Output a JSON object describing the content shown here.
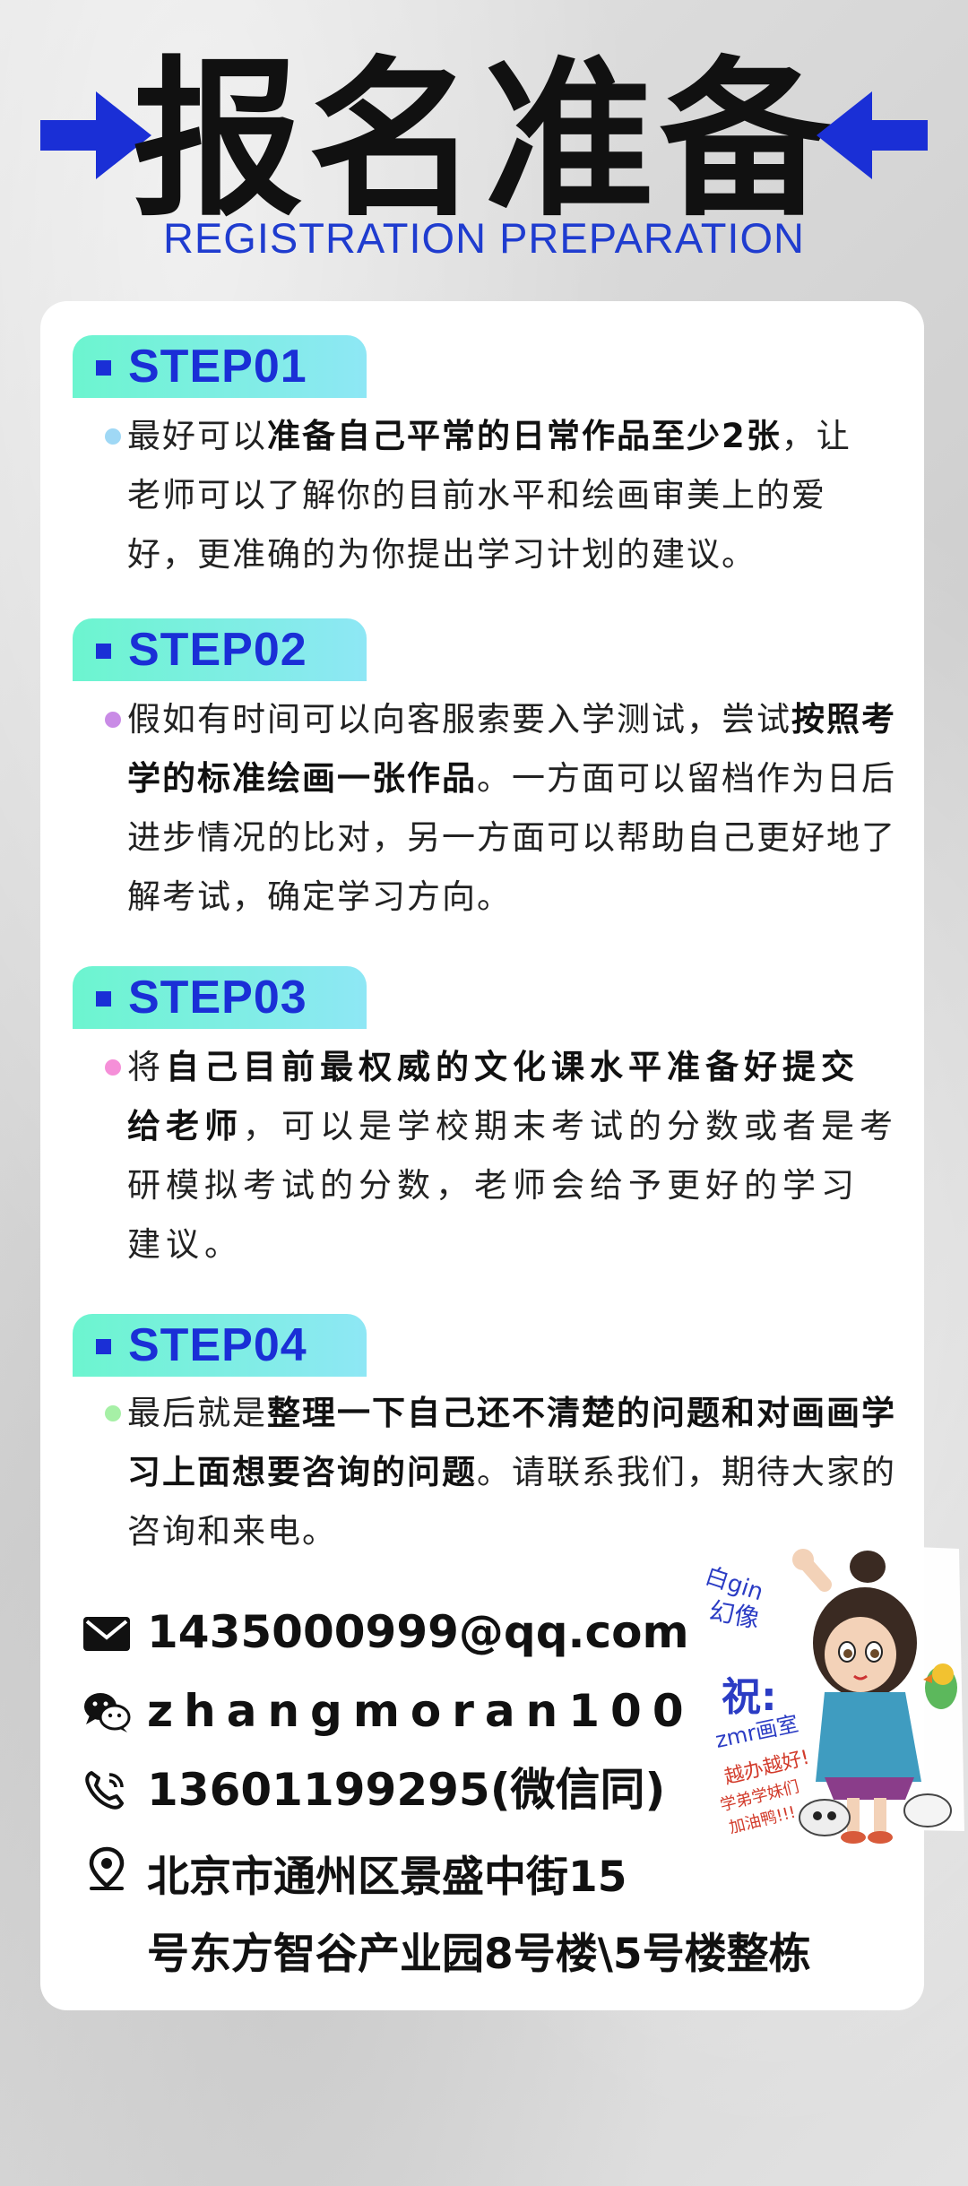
{
  "header": {
    "title": "报名准备",
    "subtitle": "REGISTRATION PREPARATION"
  },
  "colors": {
    "accent_blue": "#1a2fd6",
    "tag_gradient_start": "#6cf5cf",
    "tag_gradient_end": "#8ee7f5",
    "dot_step1": "#9fd8f5",
    "dot_step2": "#c98be6",
    "dot_step3": "#f58fd8",
    "dot_step4": "#a6f0a6"
  },
  "steps": [
    {
      "label": "STEP01",
      "lines": [
        [
          "最好可以",
          "准备自己平常的日常作品至少2张",
          "，让"
        ],
        [
          "老师可以了解你的目前水平和绘画审美上的爱"
        ],
        [
          "好，更准确的为你提出学习计划的建议。"
        ]
      ]
    },
    {
      "label": "STEP02",
      "lines": [
        [
          "假如有时间可以向客服索要入学测试，尝试",
          "按照考"
        ],
        [
          "学的标准绘画一张作品",
          "。一方面可以留档作为日后"
        ],
        [
          "进步情况的比对，另一方面可以帮助自己更好地了"
        ],
        [
          "解考试，确定学习方向。"
        ]
      ]
    },
    {
      "label": "STEP03",
      "lines": [
        [
          "将",
          "自己目前最权威的文化课水平准备好提交"
        ],
        [
          "给老师",
          "，可以是学校期末考试的分数或者是考"
        ],
        [
          "研模拟考试的分数，老师会给予更好的学习"
        ],
        [
          "建议。"
        ]
      ]
    },
    {
      "label": "STEP04",
      "lines": [
        [
          "最后就是",
          "整理一下自己还不清楚的问题和对画画学"
        ],
        [
          "习上面想要咨询的问题",
          "。请联系我们，期待大家的"
        ],
        [
          "咨询和来电。"
        ]
      ]
    }
  ],
  "contact": {
    "email": "1435000999@qq.com",
    "wechat": "zhangmoran100",
    "phone": "13601199295(微信同)",
    "address_line1": "北京市通州区景盛中街15",
    "address_line2": "号东方智谷产业园8号楼\\5号楼整栋"
  },
  "icons": [
    "arrow-right-icon",
    "arrow-left-icon",
    "mail-icon",
    "wechat-icon",
    "phone-icon",
    "location-pin-icon"
  ],
  "sticker": {
    "text_1": "白gin",
    "text_2": "幻像",
    "text_3": "祝:",
    "text_4": "zmr画室",
    "text_5": "越办越好!",
    "text_6": "学弟学妹们",
    "text_7": "加油鸭!!!"
  }
}
